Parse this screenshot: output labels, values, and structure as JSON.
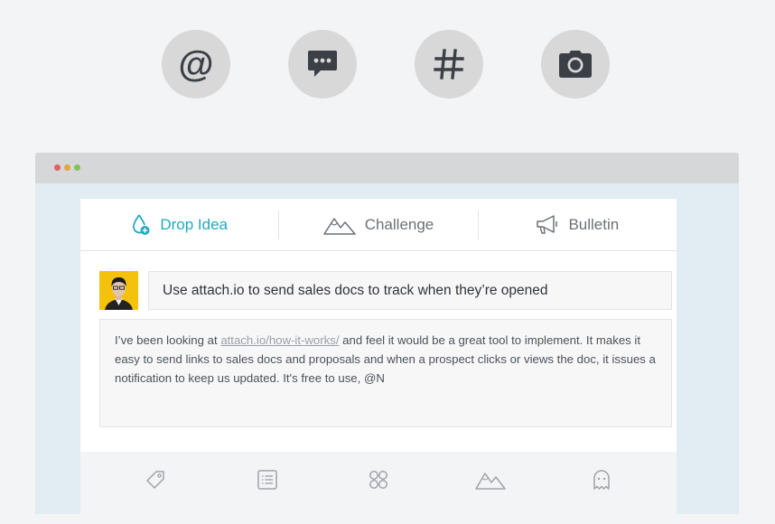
{
  "top_actions": [
    {
      "icon": "at-sign-icon",
      "glyph": "@"
    },
    {
      "icon": "chat-bubble-icon"
    },
    {
      "icon": "hashtag-icon",
      "glyph": "#"
    },
    {
      "icon": "camera-icon"
    }
  ],
  "tabs": [
    {
      "label": "Drop Idea",
      "icon": "water-drop-plus-icon",
      "active": true
    },
    {
      "label": "Challenge",
      "icon": "mountains-icon",
      "active": false
    },
    {
      "label": "Bulletin",
      "icon": "megaphone-icon",
      "active": false
    }
  ],
  "post": {
    "title": "Use attach.io to send sales docs to track when they’re opened",
    "body_before": "I’ve been looking at ",
    "body_link": "attach.io/how-it-works/",
    "body_after": " and feel it would be a great tool to implement. It makes it easy to send links to sales docs and proposals and when a prospect clicks or views the doc, it issues a notification to keep us updated. It's free to use, @N"
  },
  "footer_icons": [
    "tag-icon",
    "list-icon",
    "grid-circles-icon",
    "mountains-icon",
    "ghost-icon"
  ],
  "colors": {
    "accent": "#1fa9be",
    "avatar_bg": "#f4c20d",
    "window_red": "#e2605d",
    "window_yellow": "#e7a33e",
    "window_green": "#80c25b"
  }
}
